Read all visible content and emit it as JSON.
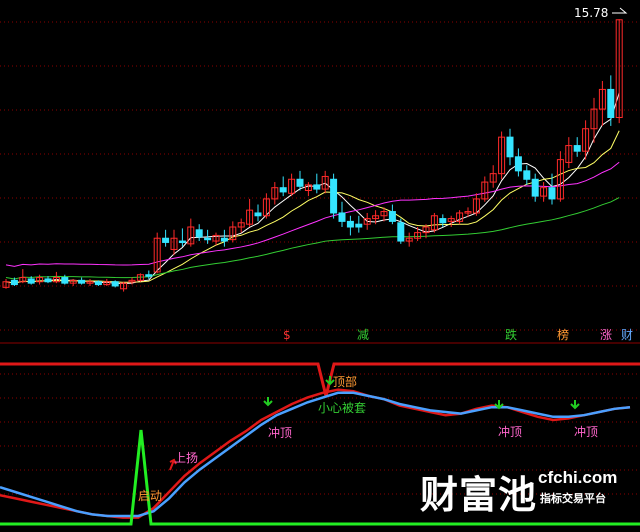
{
  "colors": {
    "background": "#000000",
    "grid": "#8b0000",
    "candle_up": "#ff2a2a",
    "candle_down": "#35e4ff",
    "ma1": "#ffffff",
    "ma2": "#ffff66",
    "ma3": "#ff33ff",
    "ma4": "#33cc33",
    "indicator_red": "#e01818",
    "indicator_blue": "#4aa0ff",
    "top_line": "#e01818",
    "signal_green": "#22ee22",
    "arrow_green": "#22cc22",
    "label_pink": "#ff66cc",
    "label_orange": "#ff9933",
    "label_green": "#33cc33"
  },
  "chart_data": [
    {
      "type": "candlestick",
      "price_label": "15.78",
      "ylim": [
        5.8,
        16.2
      ],
      "grid": true,
      "candles": [
        {
          "o": 6.25,
          "h": 6.55,
          "l": 6.2,
          "c": 6.45
        },
        {
          "o": 6.5,
          "h": 6.6,
          "l": 6.3,
          "c": 6.35
        },
        {
          "o": 6.45,
          "h": 6.9,
          "l": 6.4,
          "c": 6.6
        },
        {
          "o": 6.55,
          "h": 6.65,
          "l": 6.35,
          "c": 6.4
        },
        {
          "o": 6.45,
          "h": 6.7,
          "l": 6.35,
          "c": 6.6
        },
        {
          "o": 6.55,
          "h": 6.65,
          "l": 6.4,
          "c": 6.45
        },
        {
          "o": 6.45,
          "h": 6.8,
          "l": 6.4,
          "c": 6.6
        },
        {
          "o": 6.6,
          "h": 6.7,
          "l": 6.35,
          "c": 6.4
        },
        {
          "o": 6.4,
          "h": 6.55,
          "l": 6.3,
          "c": 6.5
        },
        {
          "o": 6.5,
          "h": 6.6,
          "l": 6.35,
          "c": 6.4
        },
        {
          "o": 6.4,
          "h": 6.55,
          "l": 6.3,
          "c": 6.45
        },
        {
          "o": 6.45,
          "h": 6.5,
          "l": 6.3,
          "c": 6.35
        },
        {
          "o": 6.35,
          "h": 6.55,
          "l": 6.3,
          "c": 6.45
        },
        {
          "o": 6.45,
          "h": 6.5,
          "l": 6.25,
          "c": 6.3
        },
        {
          "o": 6.2,
          "h": 6.45,
          "l": 6.1,
          "c": 6.4
        },
        {
          "o": 6.45,
          "h": 6.6,
          "l": 6.35,
          "c": 6.5
        },
        {
          "o": 6.5,
          "h": 6.75,
          "l": 6.45,
          "c": 6.7
        },
        {
          "o": 6.7,
          "h": 6.85,
          "l": 6.55,
          "c": 6.65
        },
        {
          "o": 6.8,
          "h": 8.2,
          "l": 6.75,
          "c": 8.0
        },
        {
          "o": 8.0,
          "h": 8.3,
          "l": 7.7,
          "c": 7.85
        },
        {
          "o": 7.6,
          "h": 8.3,
          "l": 7.4,
          "c": 8.0
        },
        {
          "o": 7.9,
          "h": 8.35,
          "l": 7.7,
          "c": 7.85
        },
        {
          "o": 7.8,
          "h": 8.7,
          "l": 7.7,
          "c": 8.4
        },
        {
          "o": 8.3,
          "h": 8.5,
          "l": 7.9,
          "c": 8.05
        },
        {
          "o": 8.0,
          "h": 8.3,
          "l": 7.8,
          "c": 7.95
        },
        {
          "o": 7.9,
          "h": 8.2,
          "l": 7.75,
          "c": 8.1
        },
        {
          "o": 8.0,
          "h": 8.3,
          "l": 7.7,
          "c": 7.9
        },
        {
          "o": 7.95,
          "h": 8.6,
          "l": 7.85,
          "c": 8.4
        },
        {
          "o": 8.4,
          "h": 8.7,
          "l": 8.2,
          "c": 8.55
        },
        {
          "o": 8.5,
          "h": 9.4,
          "l": 8.4,
          "c": 9.0
        },
        {
          "o": 8.9,
          "h": 9.2,
          "l": 8.6,
          "c": 8.8
        },
        {
          "o": 8.8,
          "h": 9.6,
          "l": 8.7,
          "c": 9.4
        },
        {
          "o": 9.4,
          "h": 10.0,
          "l": 9.2,
          "c": 9.8
        },
        {
          "o": 9.8,
          "h": 10.2,
          "l": 9.5,
          "c": 9.65
        },
        {
          "o": 9.6,
          "h": 10.3,
          "l": 9.5,
          "c": 10.1
        },
        {
          "o": 10.1,
          "h": 10.4,
          "l": 9.7,
          "c": 9.85
        },
        {
          "o": 9.7,
          "h": 10.0,
          "l": 9.5,
          "c": 9.9
        },
        {
          "o": 9.9,
          "h": 10.3,
          "l": 9.6,
          "c": 9.75
        },
        {
          "o": 9.75,
          "h": 10.4,
          "l": 9.6,
          "c": 10.2
        },
        {
          "o": 10.1,
          "h": 10.3,
          "l": 8.7,
          "c": 8.9
        },
        {
          "o": 8.9,
          "h": 9.3,
          "l": 8.4,
          "c": 8.6
        },
        {
          "o": 8.6,
          "h": 8.8,
          "l": 8.1,
          "c": 8.4
        },
        {
          "o": 8.5,
          "h": 8.8,
          "l": 8.2,
          "c": 8.4
        },
        {
          "o": 8.5,
          "h": 8.9,
          "l": 8.3,
          "c": 8.7
        },
        {
          "o": 8.7,
          "h": 9.0,
          "l": 8.5,
          "c": 8.8
        },
        {
          "o": 8.8,
          "h": 9.1,
          "l": 8.6,
          "c": 8.95
        },
        {
          "o": 8.95,
          "h": 9.2,
          "l": 8.5,
          "c": 8.6
        },
        {
          "o": 8.55,
          "h": 8.7,
          "l": 7.8,
          "c": 7.9
        },
        {
          "o": 7.9,
          "h": 8.2,
          "l": 7.7,
          "c": 8.0
        },
        {
          "o": 8.0,
          "h": 8.4,
          "l": 7.9,
          "c": 8.2
        },
        {
          "o": 8.2,
          "h": 8.5,
          "l": 8.0,
          "c": 8.4
        },
        {
          "o": 8.3,
          "h": 8.9,
          "l": 8.2,
          "c": 8.8
        },
        {
          "o": 8.7,
          "h": 8.85,
          "l": 8.4,
          "c": 8.55
        },
        {
          "o": 8.6,
          "h": 8.8,
          "l": 8.4,
          "c": 8.7
        },
        {
          "o": 8.6,
          "h": 9.0,
          "l": 8.5,
          "c": 8.9
        },
        {
          "o": 8.9,
          "h": 9.1,
          "l": 8.75,
          "c": 8.95
        },
        {
          "o": 8.9,
          "h": 9.6,
          "l": 8.8,
          "c": 9.4
        },
        {
          "o": 9.4,
          "h": 10.2,
          "l": 9.3,
          "c": 10.0
        },
        {
          "o": 10.0,
          "h": 10.6,
          "l": 9.8,
          "c": 10.3
        },
        {
          "o": 10.3,
          "h": 11.8,
          "l": 10.1,
          "c": 11.6
        },
        {
          "o": 11.6,
          "h": 11.9,
          "l": 10.6,
          "c": 10.9
        },
        {
          "o": 10.9,
          "h": 11.2,
          "l": 10.2,
          "c": 10.4
        },
        {
          "o": 10.4,
          "h": 10.6,
          "l": 9.9,
          "c": 10.1
        },
        {
          "o": 10.1,
          "h": 10.3,
          "l": 9.3,
          "c": 9.5
        },
        {
          "o": 9.5,
          "h": 10.0,
          "l": 9.3,
          "c": 9.8
        },
        {
          "o": 9.8,
          "h": 10.3,
          "l": 9.2,
          "c": 9.4
        },
        {
          "o": 9.4,
          "h": 11.1,
          "l": 9.3,
          "c": 10.8
        },
        {
          "o": 10.7,
          "h": 11.6,
          "l": 10.5,
          "c": 11.3
        },
        {
          "o": 11.3,
          "h": 11.6,
          "l": 10.9,
          "c": 11.1
        },
        {
          "o": 11.1,
          "h": 12.2,
          "l": 10.8,
          "c": 11.9
        },
        {
          "o": 11.9,
          "h": 13.0,
          "l": 11.4,
          "c": 12.6
        },
        {
          "o": 12.6,
          "h": 13.6,
          "l": 12.0,
          "c": 13.3
        },
        {
          "o": 13.3,
          "h": 13.8,
          "l": 12.0,
          "c": 12.3
        },
        {
          "o": 12.3,
          "h": 15.8,
          "l": 12.1,
          "c": 15.78
        }
      ]
    },
    {
      "type": "line",
      "ylim": [
        0,
        100
      ],
      "series": [
        {
          "color": "red",
          "values": [
            18,
            16,
            14,
            12,
            10,
            8,
            6,
            5,
            4,
            4,
            10,
            20,
            30,
            38,
            45,
            52,
            58,
            65,
            70,
            75,
            79,
            82,
            84,
            83,
            80,
            78,
            74,
            72,
            70,
            68,
            69,
            72,
            74,
            73,
            70,
            67,
            65,
            66,
            68,
            70,
            72,
            73
          ]
        },
        {
          "color": "blue",
          "values": [
            23,
            20,
            17,
            14,
            11,
            8,
            6,
            5,
            5,
            5,
            8,
            16,
            26,
            34,
            41,
            48,
            55,
            62,
            68,
            72,
            76,
            79,
            82,
            82,
            80,
            78,
            75,
            73,
            71,
            70,
            69,
            71,
            73,
            73,
            71,
            69,
            67,
            67,
            68,
            70,
            72,
            73
          ]
        }
      ],
      "top_level": 100,
      "dips": [
        {
          "index": 22,
          "value": 80
        }
      ],
      "spike": {
        "index": 9,
        "value": 60
      },
      "signal_labels": [
        "启动",
        "上扬",
        "顶部",
        "小心被套",
        "冲顶",
        "冲顶",
        "冲顶"
      ],
      "top_markers": [
        "$",
        "减",
        "跌",
        "榜",
        "涨",
        "财"
      ]
    }
  ],
  "watermark": {
    "brand": "财富池",
    "domain": "cfchi.com",
    "tagline": "指标交易平台"
  }
}
